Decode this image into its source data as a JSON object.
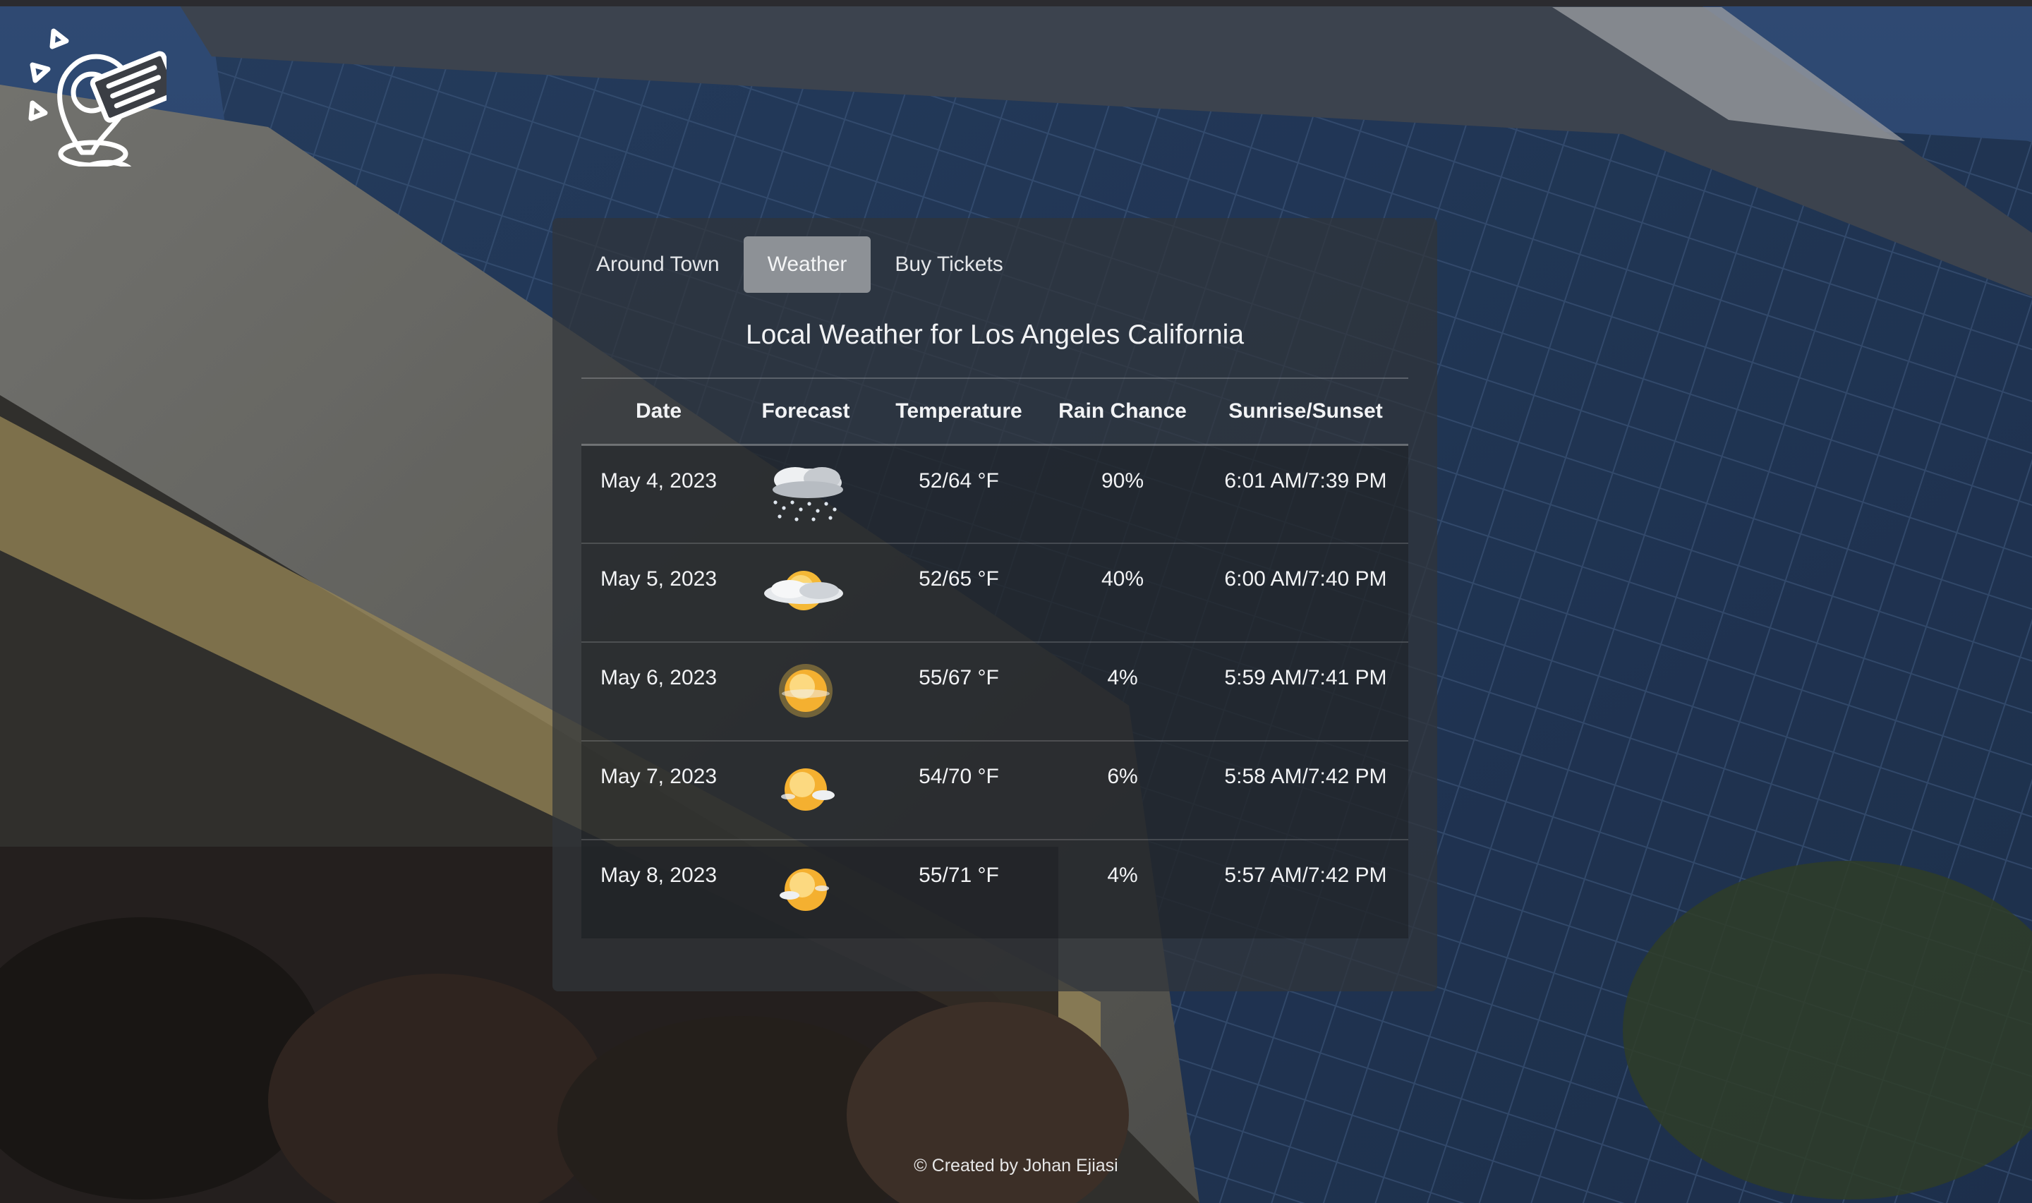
{
  "nav": {
    "tabs": [
      {
        "label": "Around Town",
        "active": false
      },
      {
        "label": "Weather",
        "active": true
      },
      {
        "label": "Buy Tickets",
        "active": false
      }
    ]
  },
  "weather": {
    "title": "Local Weather for Los Angeles California",
    "columns": [
      "Date",
      "Forecast",
      "Temperature",
      "Rain Chance",
      "Sunrise/Sunset"
    ],
    "rows": [
      {
        "date": "May 4, 2023",
        "forecast_icon": "rain-cloud-icon",
        "temperature": "52/64 °F",
        "rain_chance": "90%",
        "sunrise_sunset": "6:01 AM/7:39 PM"
      },
      {
        "date": "May 5, 2023",
        "forecast_icon": "partly-cloudy-icon",
        "temperature": "52/65 °F",
        "rain_chance": "40%",
        "sunrise_sunset": "6:00 AM/7:40 PM"
      },
      {
        "date": "May 6, 2023",
        "forecast_icon": "sun-haze-icon",
        "temperature": "55/67 °F",
        "rain_chance": "4%",
        "sunrise_sunset": "5:59 AM/7:41 PM"
      },
      {
        "date": "May 7, 2023",
        "forecast_icon": "sun-small-cloud-icon",
        "temperature": "54/70 °F",
        "rain_chance": "6%",
        "sunrise_sunset": "5:58 AM/7:42 PM"
      },
      {
        "date": "May 8, 2023",
        "forecast_icon": "sun-small-cloud-icon",
        "temperature": "55/71 °F",
        "rain_chance": "4%",
        "sunrise_sunset": "5:57 AM/7:42 PM"
      }
    ]
  },
  "footer": {
    "text": "© Created by Johan Ejiasi"
  },
  "colors": {
    "panel_bg": "#30343a",
    "active_tab": "#8d9196",
    "text": "#f2f3f5"
  }
}
